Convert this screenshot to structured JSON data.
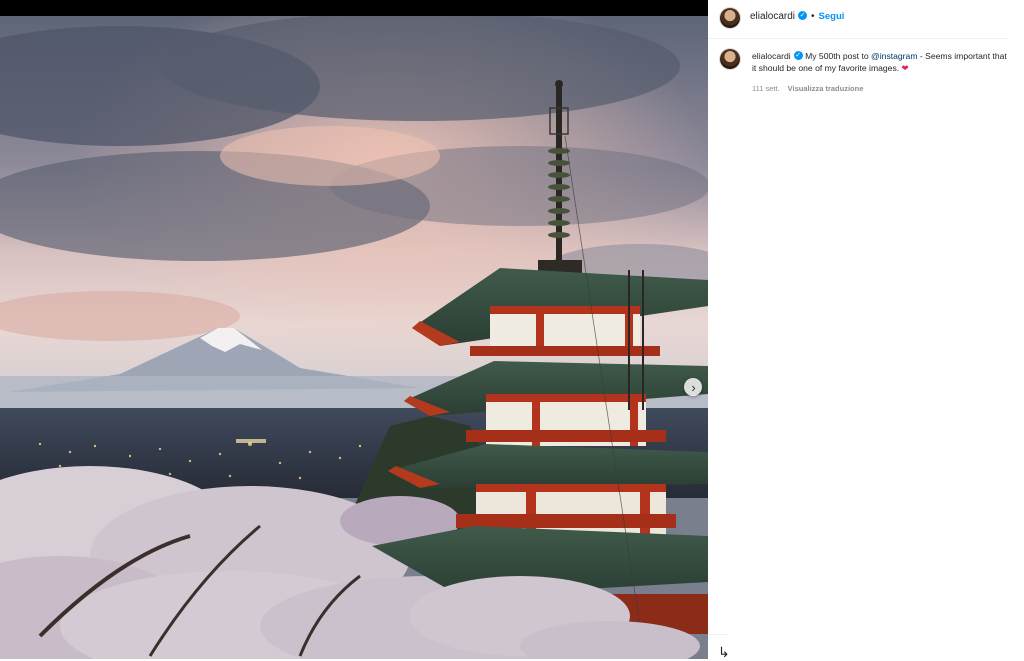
{
  "post": {
    "username": "elialocardi",
    "separator": "•",
    "follow_label": "Segui"
  },
  "caption": {
    "username": "elialocardi",
    "text_before": "My 500th post to",
    "mention": "@instagram",
    "text_after": "- Seems important that it should be one of my favorite images.",
    "heart": "❤",
    "time": "111 sett.",
    "translate_label": "Visualizza traduzione"
  },
  "carousel": {
    "next_glyph": "›"
  },
  "icons": {
    "verified": "verified-badge-icon",
    "next": "chevron-right-icon",
    "bottom": "share-icon"
  },
  "bottom_glyph": "↳",
  "colors": {
    "link_blue": "#0095f6",
    "mention_blue": "#00376b",
    "heart_red": "#e0245e",
    "meta_gray": "#8e8e8e"
  }
}
